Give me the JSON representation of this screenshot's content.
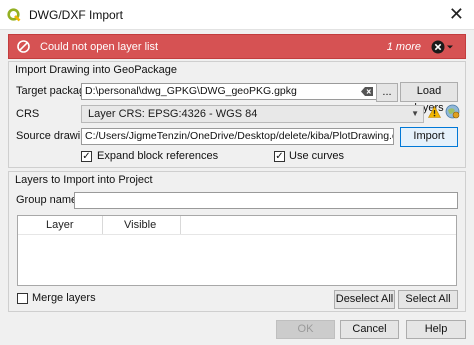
{
  "window": {
    "title": "DWG/DXF Import"
  },
  "message": {
    "text": "Could not open layer list",
    "more": "1 more"
  },
  "import_group": {
    "title": "Import Drawing into GeoPackage",
    "target_label": "Target package",
    "target_value": "D:\\personal\\dwg_GPKG\\DWG_geoPKG.gpkg",
    "browse_label": "...",
    "load_layers_label": "Load layers",
    "crs_label": "CRS",
    "crs_value": "Layer CRS: EPSG:4326 - WGS 84",
    "source_label": "Source drawing",
    "source_value": "C:/Users/JigmeTenzin/OneDrive/Desktop/delete/kiba/PlotDrawing.dwg",
    "import_label": "Import",
    "expand_label": "Expand block references",
    "expand_checked": true,
    "curves_label": "Use curves",
    "curves_checked": true
  },
  "layers_group": {
    "title": "Layers to Import into Project",
    "group_name_label": "Group name",
    "group_name_value": "",
    "columns": [
      "Layer",
      "Visible"
    ],
    "merge_label": "Merge layers",
    "merge_checked": false,
    "deselect_label": "Deselect All",
    "select_label": "Select All"
  },
  "footer": {
    "ok_label": "OK",
    "cancel_label": "Cancel",
    "help_label": "Help"
  },
  "colors": {
    "error_bar": "#d65253",
    "qgis_green": "#93b023",
    "warning": "#f2b600"
  }
}
